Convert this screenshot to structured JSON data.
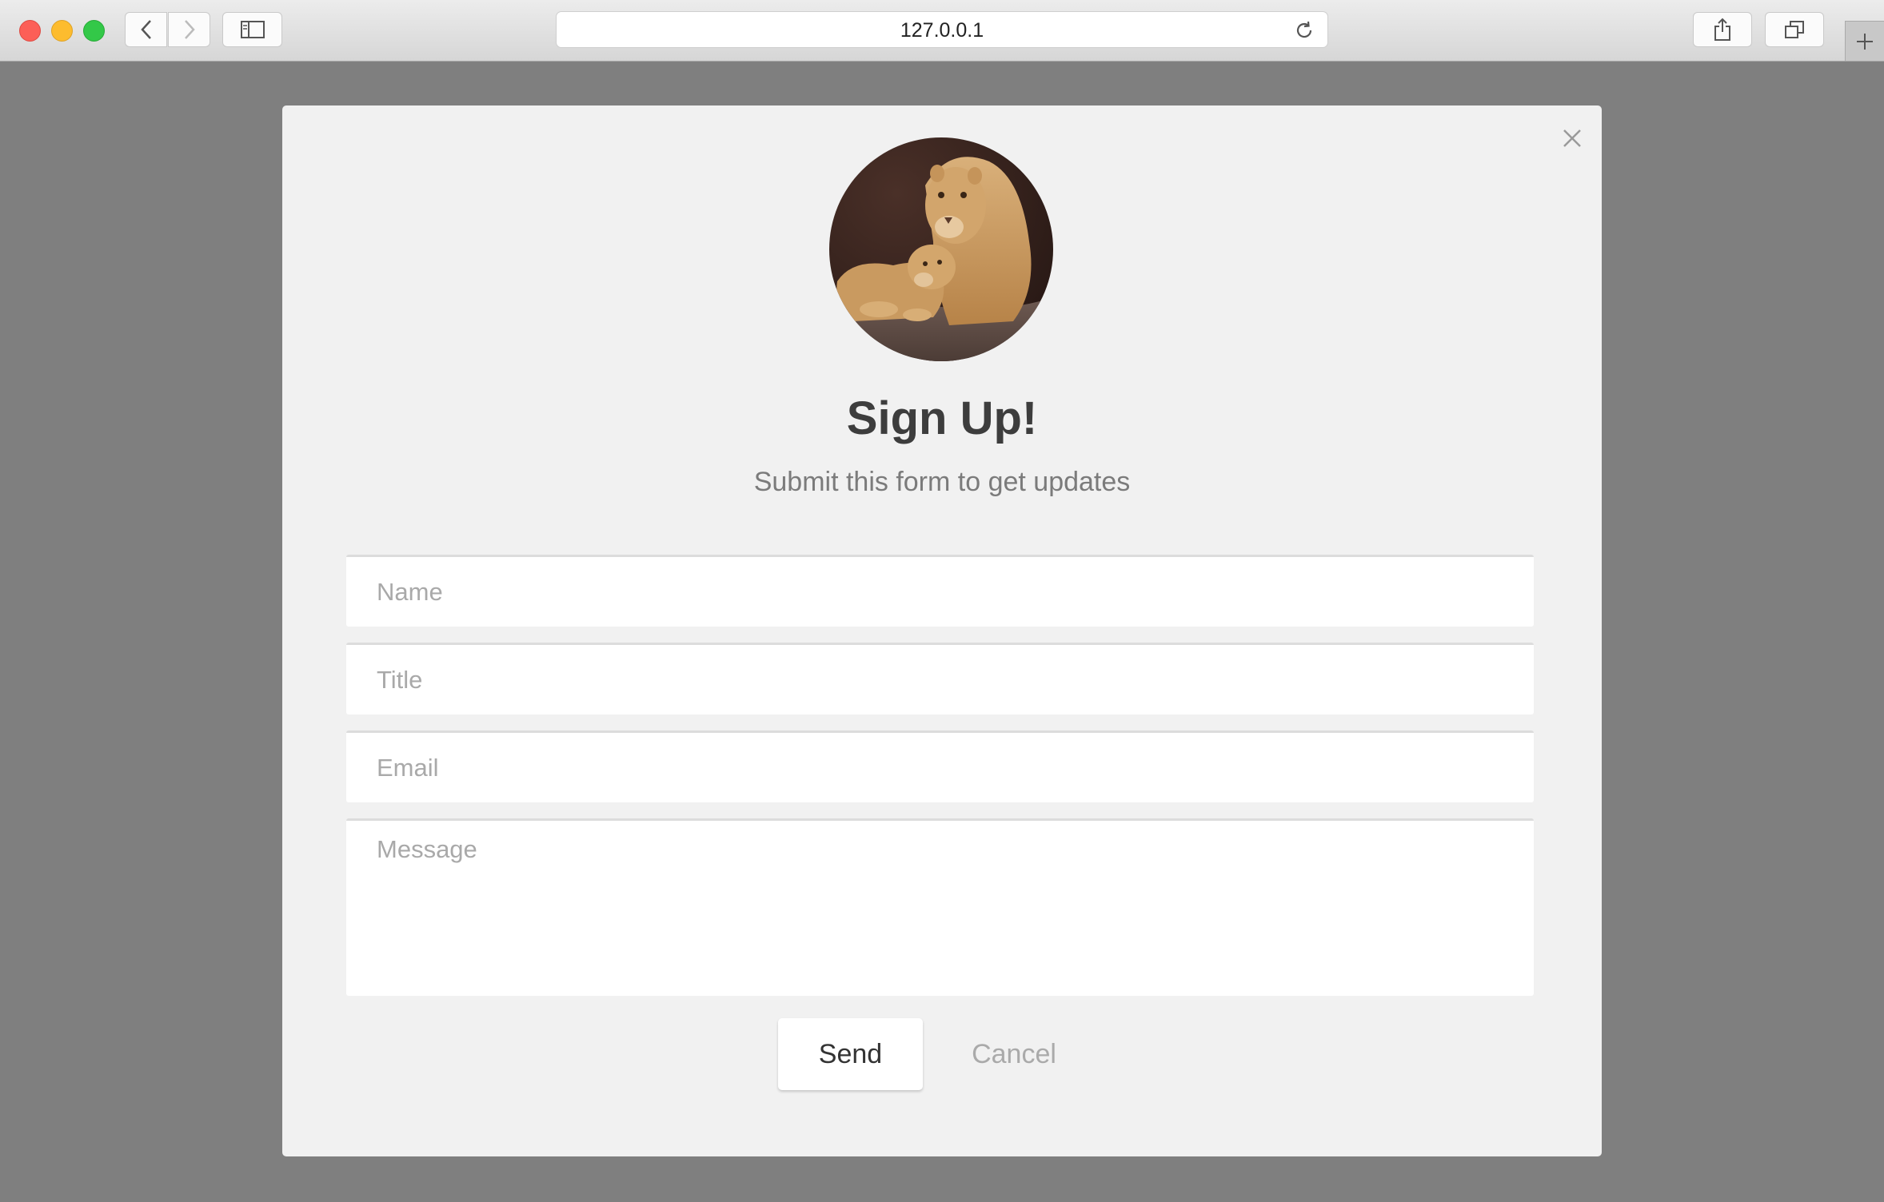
{
  "browser": {
    "url": "127.0.0.1",
    "icons": [
      "close-window-icon",
      "minimize-window-icon",
      "zoom-window-icon",
      "back-arrow-icon",
      "forward-arrow-icon",
      "sidebar-icon",
      "reload-icon",
      "share-icon",
      "tabs-icon",
      "plus-icon"
    ]
  },
  "modal": {
    "avatar_icon": "lioness-and-cub-photo",
    "title": "Sign Up!",
    "subtitle": "Submit this form to get updates",
    "fields": {
      "name_placeholder": "Name",
      "title_placeholder": "Title",
      "email_placeholder": "Email",
      "message_placeholder": "Message"
    },
    "send_label": "Send",
    "cancel_label": "Cancel",
    "close_icon": "close-icon"
  },
  "colors": {
    "page_bg": "#7f7f7f",
    "modal_bg": "#f1f1f1",
    "title": "#3d3d3d",
    "subtitle": "#7b7b7b"
  }
}
